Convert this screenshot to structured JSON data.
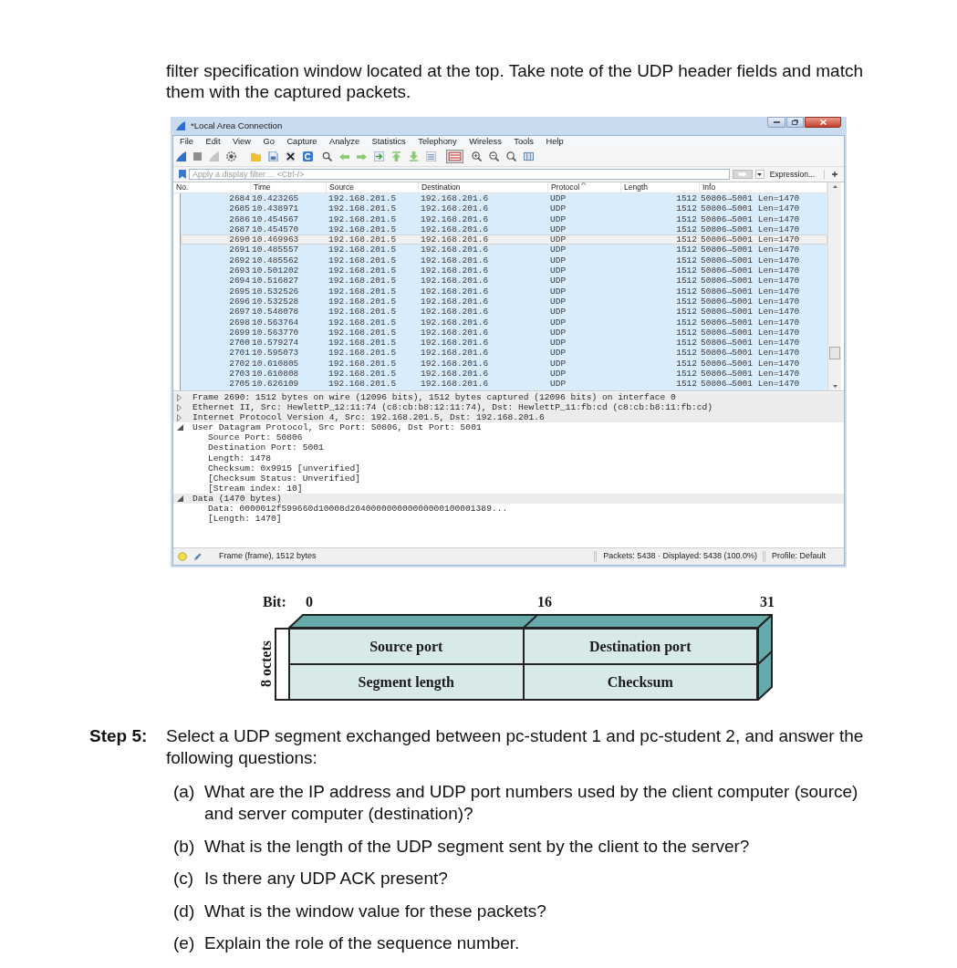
{
  "intro_text": "filter specification window located at the top. Take note of the UDP header fields and match them with the captured packets.",
  "wireshark_window": {
    "title": "*Local Area Connection",
    "menu": [
      "File",
      "Edit",
      "View",
      "Go",
      "Capture",
      "Analyze",
      "Statistics",
      "Telephony",
      "Wireless",
      "Tools",
      "Help"
    ],
    "filter": {
      "placeholder": "Apply a display filter ... <Ctrl-/>",
      "expression_button": "Expression..."
    },
    "packet_list": {
      "columns": [
        {
          "label": "No.",
          "sorted": false
        },
        {
          "label": "Time",
          "sorted": false
        },
        {
          "label": "Source",
          "sorted": false
        },
        {
          "label": "Destination",
          "sorted": false
        },
        {
          "label": "Protocol",
          "sorted": true
        },
        {
          "label": "Length",
          "sorted": false
        },
        {
          "label": "Info",
          "sorted": false
        }
      ],
      "rows": [
        {
          "no": "2684",
          "time": "10.423265",
          "source": "192.168.201.5",
          "destination": "192.168.201.6",
          "protocol": "UDP",
          "length": "1512",
          "info": "50806→5001 Len=1470",
          "selected": false
        },
        {
          "no": "2685",
          "time": "10.438971",
          "source": "192.168.201.5",
          "destination": "192.168.201.6",
          "protocol": "UDP",
          "length": "1512",
          "info": "50806→5001 Len=1470",
          "selected": false
        },
        {
          "no": "2686",
          "time": "10.454567",
          "source": "192.168.201.5",
          "destination": "192.168.201.6",
          "protocol": "UDP",
          "length": "1512",
          "info": "50806→5001 Len=1470",
          "selected": false
        },
        {
          "no": "2687",
          "time": "10.454570",
          "source": "192.168.201.5",
          "destination": "192.168.201.6",
          "protocol": "UDP",
          "length": "1512",
          "info": "50806→5001 Len=1470",
          "selected": false
        },
        {
          "no": "2690",
          "time": "10.469963",
          "source": "192.168.201.5",
          "destination": "192.168.201.6",
          "protocol": "UDP",
          "length": "1512",
          "info": "50806→5001 Len=1470",
          "selected": true
        },
        {
          "no": "2691",
          "time": "10.485557",
          "source": "192.168.201.5",
          "destination": "192.168.201.6",
          "protocol": "UDP",
          "length": "1512",
          "info": "50806→5001 Len=1470",
          "selected": false
        },
        {
          "no": "2692",
          "time": "10.485562",
          "source": "192.168.201.5",
          "destination": "192.168.201.6",
          "protocol": "UDP",
          "length": "1512",
          "info": "50806→5001 Len=1470",
          "selected": false
        },
        {
          "no": "2693",
          "time": "10.501202",
          "source": "192.168.201.5",
          "destination": "192.168.201.6",
          "protocol": "UDP",
          "length": "1512",
          "info": "50806→5001 Len=1470",
          "selected": false
        },
        {
          "no": "2694",
          "time": "10.516827",
          "source": "192.168.201.5",
          "destination": "192.168.201.6",
          "protocol": "UDP",
          "length": "1512",
          "info": "50806→5001 Len=1470",
          "selected": false
        },
        {
          "no": "2695",
          "time": "10.532526",
          "source": "192.168.201.5",
          "destination": "192.168.201.6",
          "protocol": "UDP",
          "length": "1512",
          "info": "50806→5001 Len=1470",
          "selected": false
        },
        {
          "no": "2696",
          "time": "10.532528",
          "source": "192.168.201.5",
          "destination": "192.168.201.6",
          "protocol": "UDP",
          "length": "1512",
          "info": "50806→5001 Len=1470",
          "selected": false
        },
        {
          "no": "2697",
          "time": "10.548078",
          "source": "192.168.201.5",
          "destination": "192.168.201.6",
          "protocol": "UDP",
          "length": "1512",
          "info": "50806→5001 Len=1470",
          "selected": false
        },
        {
          "no": "2698",
          "time": "10.563764",
          "source": "192.168.201.5",
          "destination": "192.168.201.6",
          "protocol": "UDP",
          "length": "1512",
          "info": "50806→5001 Len=1470",
          "selected": false
        },
        {
          "no": "2699",
          "time": "10.563770",
          "source": "192.168.201.5",
          "destination": "192.168.201.6",
          "protocol": "UDP",
          "length": "1512",
          "info": "50806→5001 Len=1470",
          "selected": false
        },
        {
          "no": "2700",
          "time": "10.579274",
          "source": "192.168.201.5",
          "destination": "192.168.201.6",
          "protocol": "UDP",
          "length": "1512",
          "info": "50806→5001 Len=1470",
          "selected": false
        },
        {
          "no": "2701",
          "time": "10.595073",
          "source": "192.168.201.5",
          "destination": "192.168.201.6",
          "protocol": "UDP",
          "length": "1512",
          "info": "50806→5001 Len=1470",
          "selected": false
        },
        {
          "no": "2702",
          "time": "10.610805",
          "source": "192.168.201.5",
          "destination": "192.168.201.6",
          "protocol": "UDP",
          "length": "1512",
          "info": "50806→5001 Len=1470",
          "selected": false
        },
        {
          "no": "2703",
          "time": "10.610808",
          "source": "192.168.201.5",
          "destination": "192.168.201.6",
          "protocol": "UDP",
          "length": "1512",
          "info": "50806→5001 Len=1470",
          "selected": false
        },
        {
          "no": "2705",
          "time": "10.626109",
          "source": "192.168.201.5",
          "destination": "192.168.201.6",
          "protocol": "UDP",
          "length": "1512",
          "info": "50806→5001 Len=1470",
          "selected": false
        }
      ]
    },
    "details": [
      {
        "text": "Frame 2690: 1512 bytes on wire (12096 bits), 1512 bytes captured (12096 bits) on interface 0",
        "expanded": false,
        "highlighted": true
      },
      {
        "text": "Ethernet II, Src: HewlettP_12:11:74 (c8:cb:b8:12:11:74), Dst: HewlettP_11:fb:cd (c8:cb:b8:11:fb:cd)",
        "expanded": false,
        "highlighted": true
      },
      {
        "text": "Internet Protocol Version 4, Src: 192.168.201.5, Dst: 192.168.201.6",
        "expanded": false,
        "highlighted": true
      },
      {
        "text": "User Datagram Protocol, Src Port: 50806, Dst Port: 5001",
        "expanded": true,
        "highlighted": false,
        "children": [
          {
            "text": "Source Port: 50806"
          },
          {
            "text": "Destination Port: 5001"
          },
          {
            "text": "Length: 1478"
          },
          {
            "text": "Checksum: 0x9915 [unverified]"
          },
          {
            "text": "[Checksum Status: Unverified]"
          },
          {
            "text": "[Stream index: 10]"
          }
        ]
      },
      {
        "text": "Data (1470 bytes)",
        "expanded": true,
        "highlighted": true,
        "children": [
          {
            "text": "Data: 0000012f599660d10008d204000000000000000100001389..."
          },
          {
            "text": "[Length: 1470]"
          }
        ]
      }
    ],
    "status_bar": {
      "frame_info": "Frame (frame), 1512 bytes",
      "packets": "Packets: 5438 · Displayed: 5438 (100.0%)",
      "profile": "Profile: Default"
    }
  },
  "udp_header_diagram": {
    "bit_label": "Bit:",
    "bit_positions": [
      "0",
      "16",
      "31"
    ],
    "side_label": "8 octets",
    "fields": [
      "Source port",
      "Destination port",
      "Segment length",
      "Checksum"
    ]
  },
  "step": {
    "label": "Step 5:",
    "text": "Select a UDP segment exchanged between pc-student 1 and pc-student 2, and answer the following questions:",
    "questions": [
      {
        "label": "(a)",
        "text": "What are the IP address and UDP port numbers used by the client computer (source) and server computer (destination)?"
      },
      {
        "label": "(b)",
        "text": "What is the length of the UDP segment sent by the client to the server?"
      },
      {
        "label": "(c)",
        "text": "Is there any UDP ACK present?"
      },
      {
        "label": "(d)",
        "text": "What is the window value for these packets?"
      },
      {
        "label": "(e)",
        "text": "Explain the role of the sequence number."
      }
    ]
  }
}
